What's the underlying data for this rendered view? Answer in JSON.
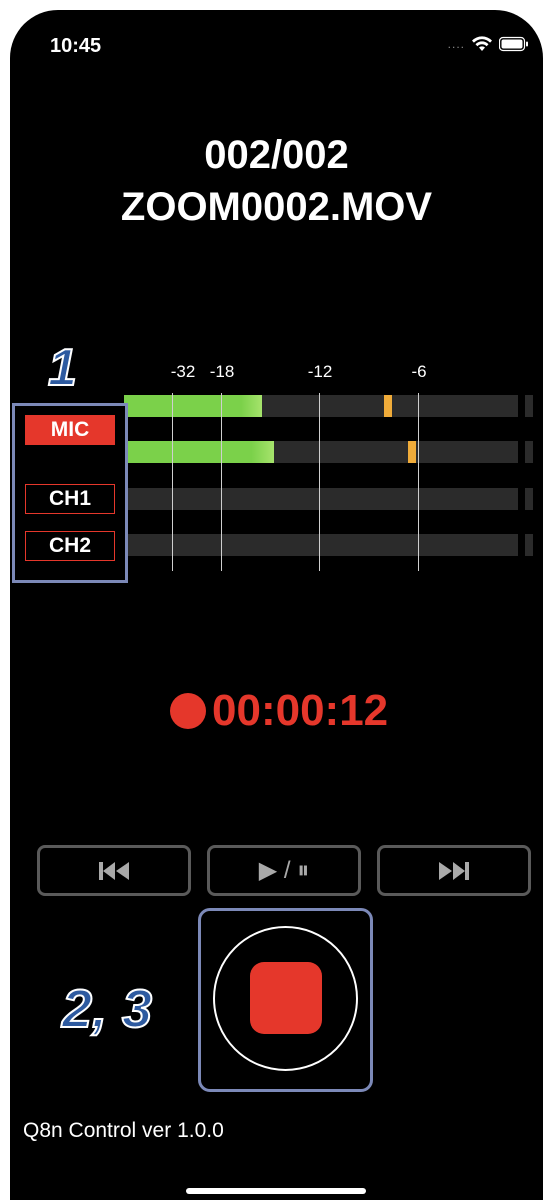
{
  "status_bar": {
    "time": "10:45",
    "signal_dots": "....",
    "wifi_icon": "wifi-icon",
    "battery_icon": "battery-icon"
  },
  "title": {
    "counter": "002/002",
    "filename": "ZOOM0002.MOV"
  },
  "annotations": {
    "marker_1": "1",
    "marker_2_3": "2, 3"
  },
  "meter": {
    "scale_labels": [
      "-32",
      "-18",
      "-12",
      "-6"
    ],
    "channels": [
      {
        "level": 0.35,
        "peak": 0.66,
        "color": "#7bd14a"
      },
      {
        "level": 0.38,
        "peak": 0.72,
        "color": "#7bd14a"
      },
      {
        "level": 0.0
      },
      {
        "level": 0.0
      }
    ],
    "peak_color": "#f0ac3a"
  },
  "channel_selector": {
    "buttons": [
      {
        "label": "MIC",
        "active": true
      },
      {
        "label": "CH1",
        "active": false
      },
      {
        "label": "CH2",
        "active": false
      }
    ]
  },
  "timer": {
    "elapsed": "00:00:12",
    "color": "#e5372b"
  },
  "transport": {
    "prev_icon": "skip-back-icon",
    "play_pause_label": "▶ / ⏸",
    "next_icon": "skip-forward-icon"
  },
  "record": {
    "icon": "stop-icon"
  },
  "footer": {
    "version": "Q8n Control ver 1.0.0"
  }
}
